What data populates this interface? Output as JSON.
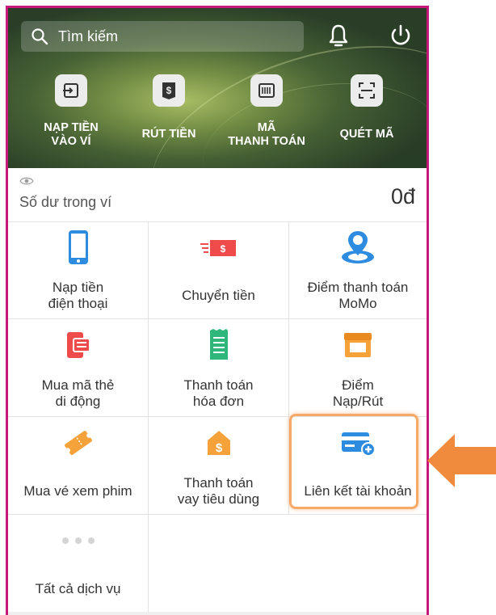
{
  "header": {
    "search_placeholder": "Tìm kiếm",
    "actions": [
      {
        "label": "NẠP TIỀN\nVÀO VÍ",
        "icon": "wallet-in-icon"
      },
      {
        "label": "RÚT TIỀN",
        "icon": "withdraw-icon"
      },
      {
        "label": "MÃ\nTHANH TOÁN",
        "icon": "barcode-icon"
      },
      {
        "label": "QUÉT MÃ",
        "icon": "scan-icon"
      }
    ]
  },
  "balance": {
    "label": "Số dư trong ví",
    "amount": "0đ"
  },
  "services": [
    {
      "label": "Nạp tiền\nđiện thoại",
      "icon": "phone-topup-icon"
    },
    {
      "label": "Chuyển tiền",
      "icon": "money-transfer-icon"
    },
    {
      "label": "Điểm thanh toán\nMoMo",
      "icon": "map-pin-icon"
    },
    {
      "label": "Mua mã thẻ\ndi động",
      "icon": "mobile-card-icon"
    },
    {
      "label": "Thanh toán\nhóa đơn",
      "icon": "bill-icon"
    },
    {
      "label": "Điểm\nNạp/Rút",
      "icon": "store-icon"
    },
    {
      "label": "Mua vé xem phim",
      "icon": "movie-ticket-icon"
    },
    {
      "label": "Thanh toán\nvay tiêu dùng",
      "icon": "loan-house-icon"
    },
    {
      "label": "Liên kết tài khoản",
      "icon": "link-bank-card-icon"
    },
    {
      "label": "Tất cả dịch vụ",
      "icon": "more-dots-icon"
    }
  ],
  "colors": {
    "frame": "#c8187a",
    "highlight": "#f7a968",
    "arrow": "#f08a3c",
    "blue": "#2e8ce0",
    "red": "#ef4b4b",
    "green": "#2fb67a",
    "orange": "#f5a23a"
  }
}
